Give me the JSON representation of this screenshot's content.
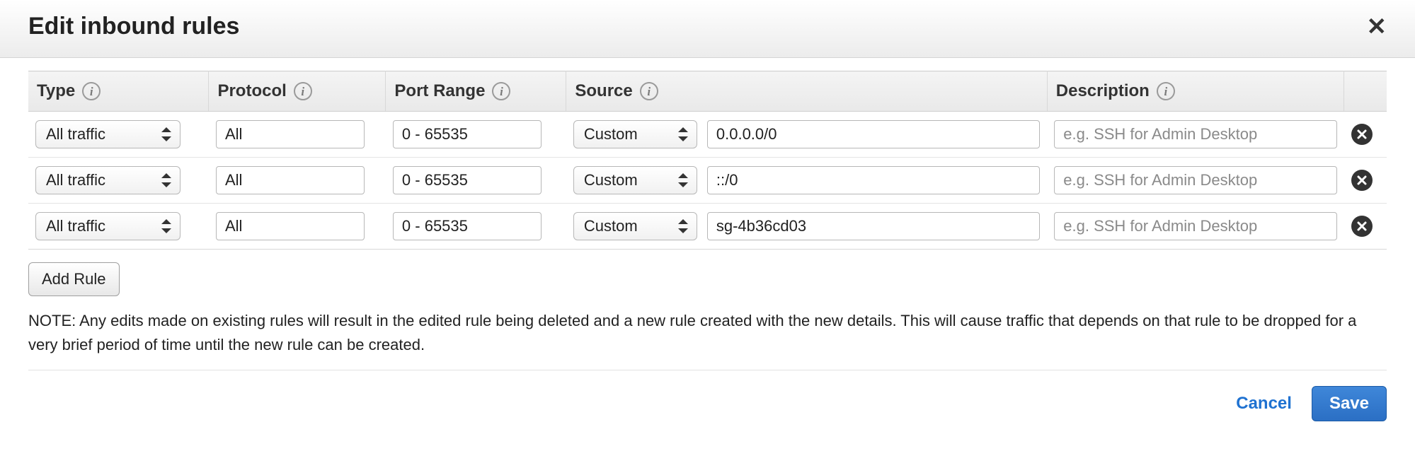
{
  "header": {
    "title": "Edit inbound rules"
  },
  "table": {
    "columns": {
      "type": "Type",
      "protocol": "Protocol",
      "portRange": "Port Range",
      "source": "Source",
      "description": "Description"
    },
    "description_placeholder": "e.g. SSH for Admin Desktop",
    "rows": [
      {
        "type": "All traffic",
        "protocol": "All",
        "portRange": "0 - 65535",
        "sourceMode": "Custom",
        "source": "0.0.0.0/0",
        "description": ""
      },
      {
        "type": "All traffic",
        "protocol": "All",
        "portRange": "0 - 65535",
        "sourceMode": "Custom",
        "source": "::/0",
        "description": ""
      },
      {
        "type": "All traffic",
        "protocol": "All",
        "portRange": "0 - 65535",
        "sourceMode": "Custom",
        "source": "sg-4b36cd03",
        "description": ""
      }
    ]
  },
  "buttons": {
    "addRule": "Add Rule",
    "cancel": "Cancel",
    "save": "Save"
  },
  "note": "NOTE: Any edits made on existing rules will result in the edited rule being deleted and a new rule created with the new details. This will cause traffic that depends on that rule to be dropped for a very brief period of time until the new rule can be created."
}
